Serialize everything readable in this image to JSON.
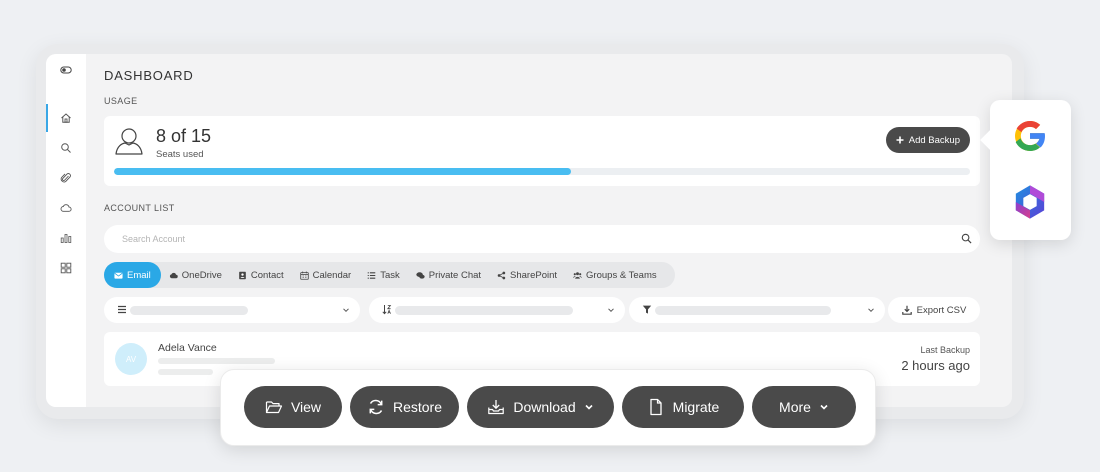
{
  "dashboard": {
    "title": "DASHBOARD",
    "usage_label": "USAGE",
    "seats": {
      "count": "8 of 15",
      "label": "Seats used",
      "used": 8,
      "total": 15
    },
    "add_backup_label": "Add Backup",
    "account_list_label": "ACCOUNT LIST",
    "search": {
      "placeholder": "Search Account"
    },
    "tabs": [
      {
        "label": "Email",
        "icon": "envelope-icon",
        "active": true
      },
      {
        "label": "OneDrive",
        "icon": "cloud-icon"
      },
      {
        "label": "Contact",
        "icon": "contact-card-icon"
      },
      {
        "label": "Calendar",
        "icon": "calendar-icon"
      },
      {
        "label": "Task",
        "icon": "list-icon"
      },
      {
        "label": "Private Chat",
        "icon": "chat-icon"
      },
      {
        "label": "SharePoint",
        "icon": "share-icon"
      },
      {
        "label": "Groups & Teams",
        "icon": "users-icon"
      }
    ],
    "filters": [
      {
        "icon": "menu-icon"
      },
      {
        "icon": "sort-icon"
      },
      {
        "icon": "funnel-icon"
      }
    ],
    "export_label": "Export CSV",
    "account": {
      "initials": "AV",
      "name": "Adela Vance",
      "last_backup_label": "Last Backup",
      "last_backup_value": "2 hours ago"
    }
  },
  "sidebar": {
    "items": [
      {
        "icon": "toggle-icon"
      },
      {
        "icon": "home-icon",
        "active": true
      },
      {
        "icon": "search-icon"
      },
      {
        "icon": "paperclip-icon"
      },
      {
        "icon": "cloud-icon"
      },
      {
        "icon": "bar-chart-icon"
      },
      {
        "icon": "grid-icon"
      }
    ]
  },
  "actions": [
    {
      "label": "View",
      "icon": "folder-open-icon"
    },
    {
      "label": "Restore",
      "icon": "restore-icon"
    },
    {
      "label": "Download",
      "icon": "download-tray-icon",
      "dropdown": true
    },
    {
      "label": "Migrate",
      "icon": "document-icon"
    },
    {
      "label": "More",
      "dropdown": true
    }
  ],
  "providers": [
    {
      "icon": "google-icon"
    },
    {
      "icon": "microsoft-365-icon"
    }
  ],
  "colors": {
    "accent": "#2aa8e6",
    "progress": "#49bdf1",
    "dark_button": "#4a4a4a"
  }
}
